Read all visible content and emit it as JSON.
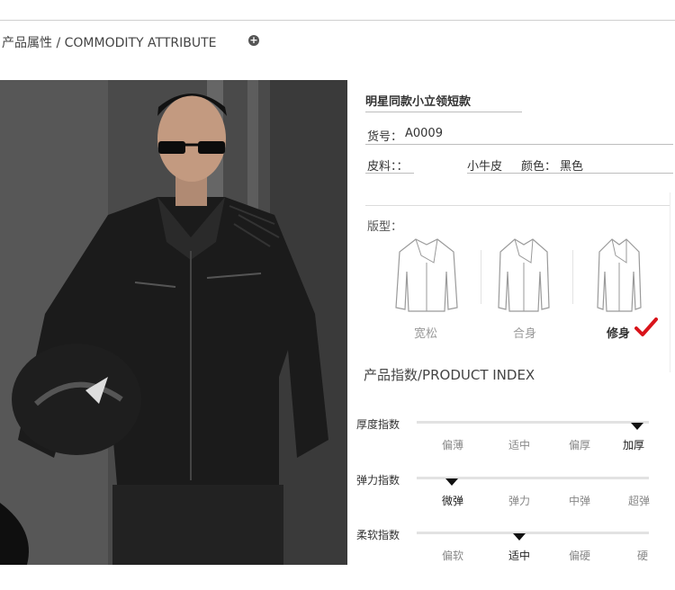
{
  "section": {
    "title": "产品属性 / COMMODITY ATTRIBUTE",
    "expand_icon": "plus-circle-icon"
  },
  "product": {
    "name": "明星同款小立领短款",
    "sku_label": "货号：",
    "sku_value": "A0009",
    "material_label": "皮料：：",
    "material_value": "小牛皮",
    "color_label": "颜色：",
    "color_value": "黑色"
  },
  "fit": {
    "label": "版型：",
    "options": [
      {
        "name": "宽松",
        "selected": false
      },
      {
        "name": "合身",
        "selected": false
      },
      {
        "name": "修身",
        "selected": true
      }
    ],
    "check_color": "#d9141b"
  },
  "index": {
    "title": "产品指数/PRODUCT INDEX",
    "rows": [
      {
        "label": "厚度指数",
        "options": [
          "偏薄",
          "适中",
          "偏厚",
          "加厚"
        ],
        "selected": 3,
        "level": 0.95
      },
      {
        "label": "弹力指数",
        "options": [
          "微弹",
          "弹力",
          "中弹",
          "超弹"
        ],
        "selected": 0,
        "level": 0.15
      },
      {
        "label": "柔软指数",
        "options": [
          "偏软",
          "适中",
          "偏硬",
          "硬"
        ],
        "selected": 1,
        "level": 0.44
      }
    ]
  }
}
